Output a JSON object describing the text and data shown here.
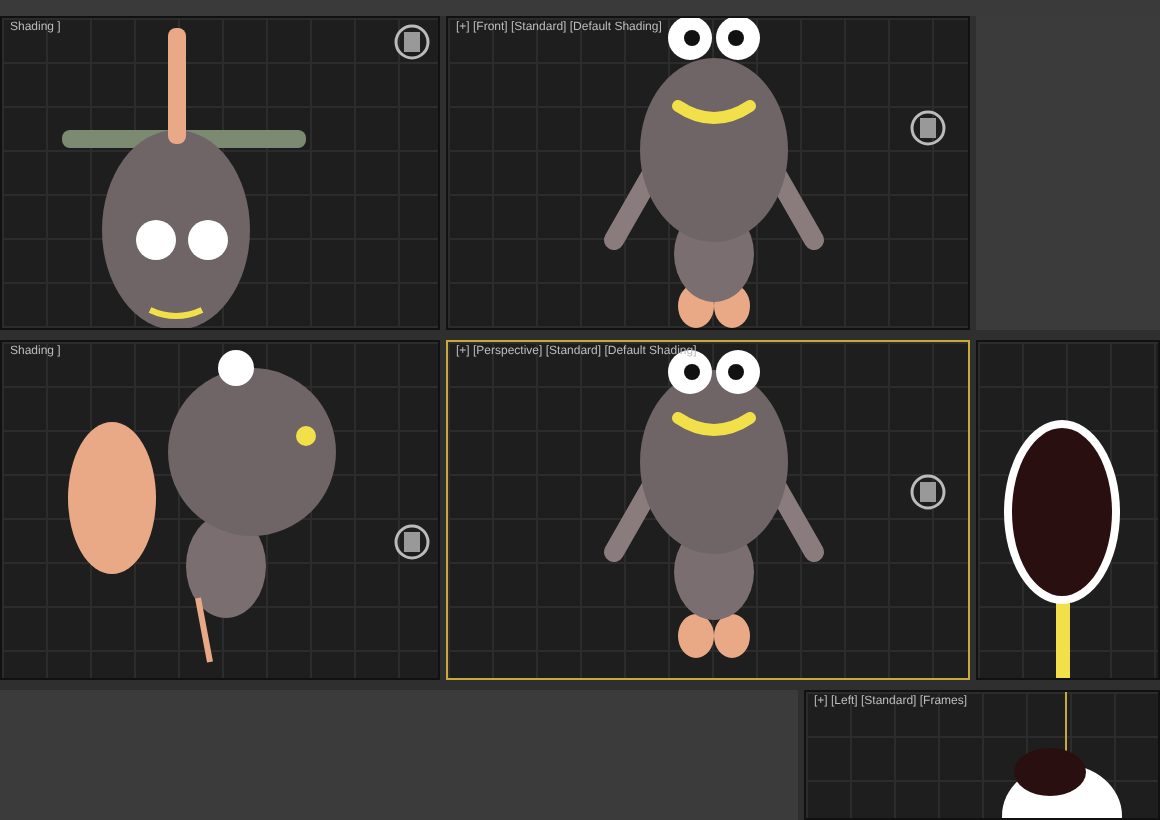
{
  "viewports": [
    {
      "label": "Shading ]",
      "kind": "top",
      "active": false
    },
    {
      "label": "[+] [Front] [Standard] [Default Shading]",
      "kind": "front",
      "active": false
    },
    {
      "label": "Shading ]",
      "kind": "side",
      "active": false
    },
    {
      "label": "[+] [Perspective] [Standard] [Default Shading]",
      "kind": "front",
      "active": true
    },
    {
      "kind": "mirror",
      "active": false
    },
    {
      "label": "[+] [Left] [Standard] [Frames]",
      "kind": "left",
      "active": false
    }
  ]
}
